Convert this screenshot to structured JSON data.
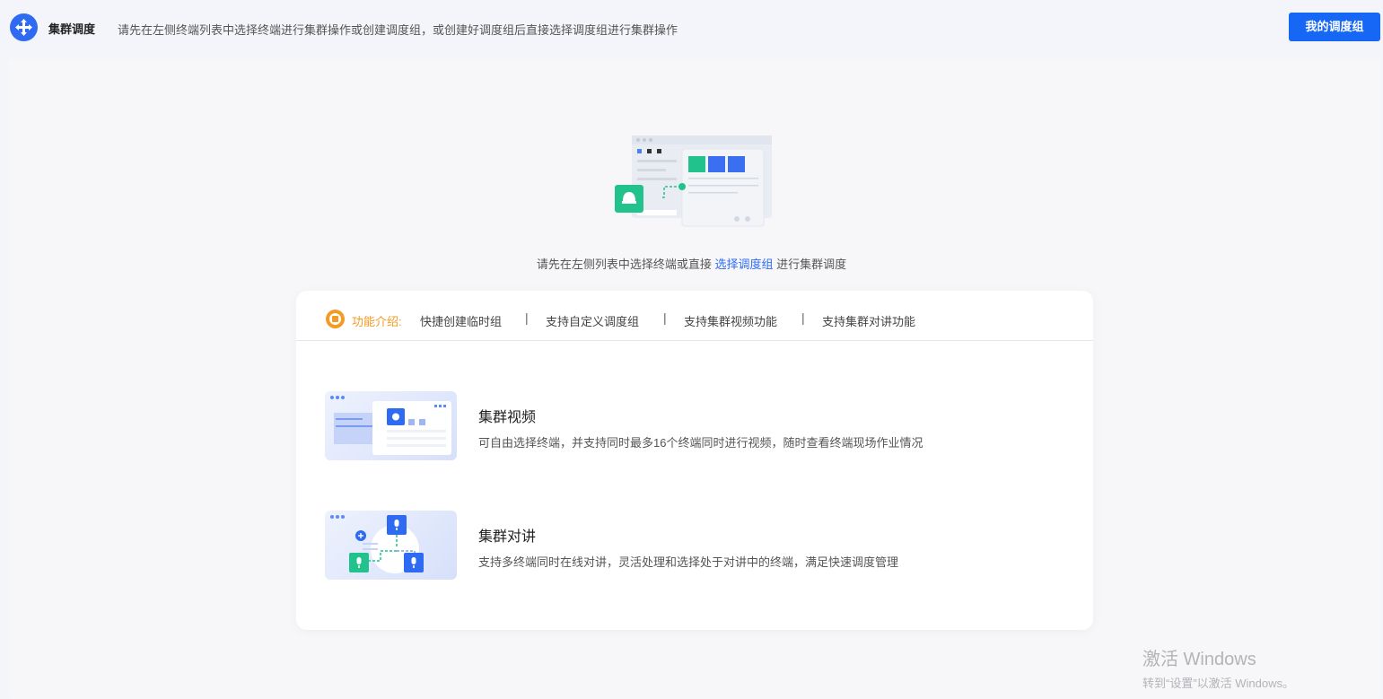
{
  "header": {
    "title": "集群调度",
    "hint": "请先在左侧终端列表中选择终端进行集群操作或创建调度组，或创建好调度组后直接选择调度组进行集群操作",
    "my_group_button": "我的调度组"
  },
  "empty_state": {
    "prefix": "请先在左侧列表中选择终端或直接",
    "link": "选择调度组",
    "suffix": "进行集群调度"
  },
  "intro": {
    "label": "功能介绍:",
    "items": [
      "快捷创建临时组",
      "支持自定义调度组",
      "支持集群视频功能",
      "支持集群对讲功能"
    ],
    "separator": "|"
  },
  "features": [
    {
      "title": "集群视频",
      "desc": "可自由选择终端，并支持同时最多16个终端同时进行视频，随时查看终端现场作业情况"
    },
    {
      "title": "集群对讲",
      "desc": "支持多终端同时在线对讲，灵活处理和选择处于对讲中的终端，满足快速调度管理"
    }
  ],
  "watermark": {
    "line1": "激活 Windows",
    "line2": "转到“设置”以激活 Windows。"
  },
  "colors": {
    "accent": "#1667f5",
    "orange": "#f59a23",
    "green": "#22c28c"
  }
}
